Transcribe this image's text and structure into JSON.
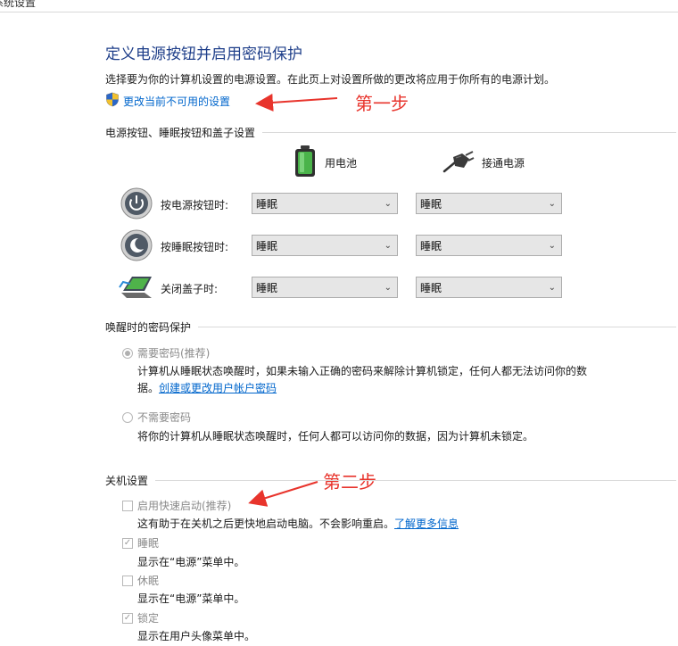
{
  "window": {
    "title": "系统设置"
  },
  "page": {
    "title": "定义电源按钮并启用密码保护",
    "description": "选择要为你的计算机设置的电源设置。在此页上对设置所做的更改将应用于你所有的电源计划。",
    "change_link": "更改当前不可用的设置"
  },
  "annotations": {
    "step1": "第一步",
    "step2": "第二步",
    "arrow_color": "#e8342c"
  },
  "buttons_section": {
    "heading": "电源按钮、睡眠按钮和盖子设置",
    "col_battery": "用电池",
    "col_plugged": "接通电源",
    "rows": [
      {
        "label": "按电源按钮时:",
        "battery": "睡眠",
        "plugged": "睡眠"
      },
      {
        "label": "按睡眠按钮时:",
        "battery": "睡眠",
        "plugged": "睡眠"
      },
      {
        "label": "关闭盖子时:",
        "battery": "睡眠",
        "plugged": "睡眠"
      }
    ]
  },
  "wake_section": {
    "heading": "唤醒时的密码保护",
    "require": {
      "label": "需要密码(推荐)",
      "text_line1": "计算机从睡眠状态唤醒时，如果未输入正确的密码来解除计算机锁定，任何人都无法访问你的数",
      "text_line2_prefix": "据。",
      "link": "创建或更改用户帐户密码"
    },
    "no_require": {
      "label": "不需要密码",
      "text": "将你的计算机从睡眠状态唤醒时，任何人都可以访问你的数据，因为计算机未锁定。"
    }
  },
  "shutdown_section": {
    "heading": "关机设置",
    "fast_startup": {
      "label": "启用快速启动(推荐)",
      "desc": "这有助于在关机之后更快地启动电脑。不会影响重启。",
      "link": "了解更多信息",
      "checked": false
    },
    "sleep": {
      "label": "睡眠",
      "desc": "显示在“电源”菜单中。",
      "checked": true
    },
    "hibernate": {
      "label": "休眠",
      "desc": "显示在“电源”菜单中。",
      "checked": false
    },
    "lock": {
      "label": "锁定",
      "desc": "显示在用户头像菜单中。",
      "checked": true
    }
  }
}
